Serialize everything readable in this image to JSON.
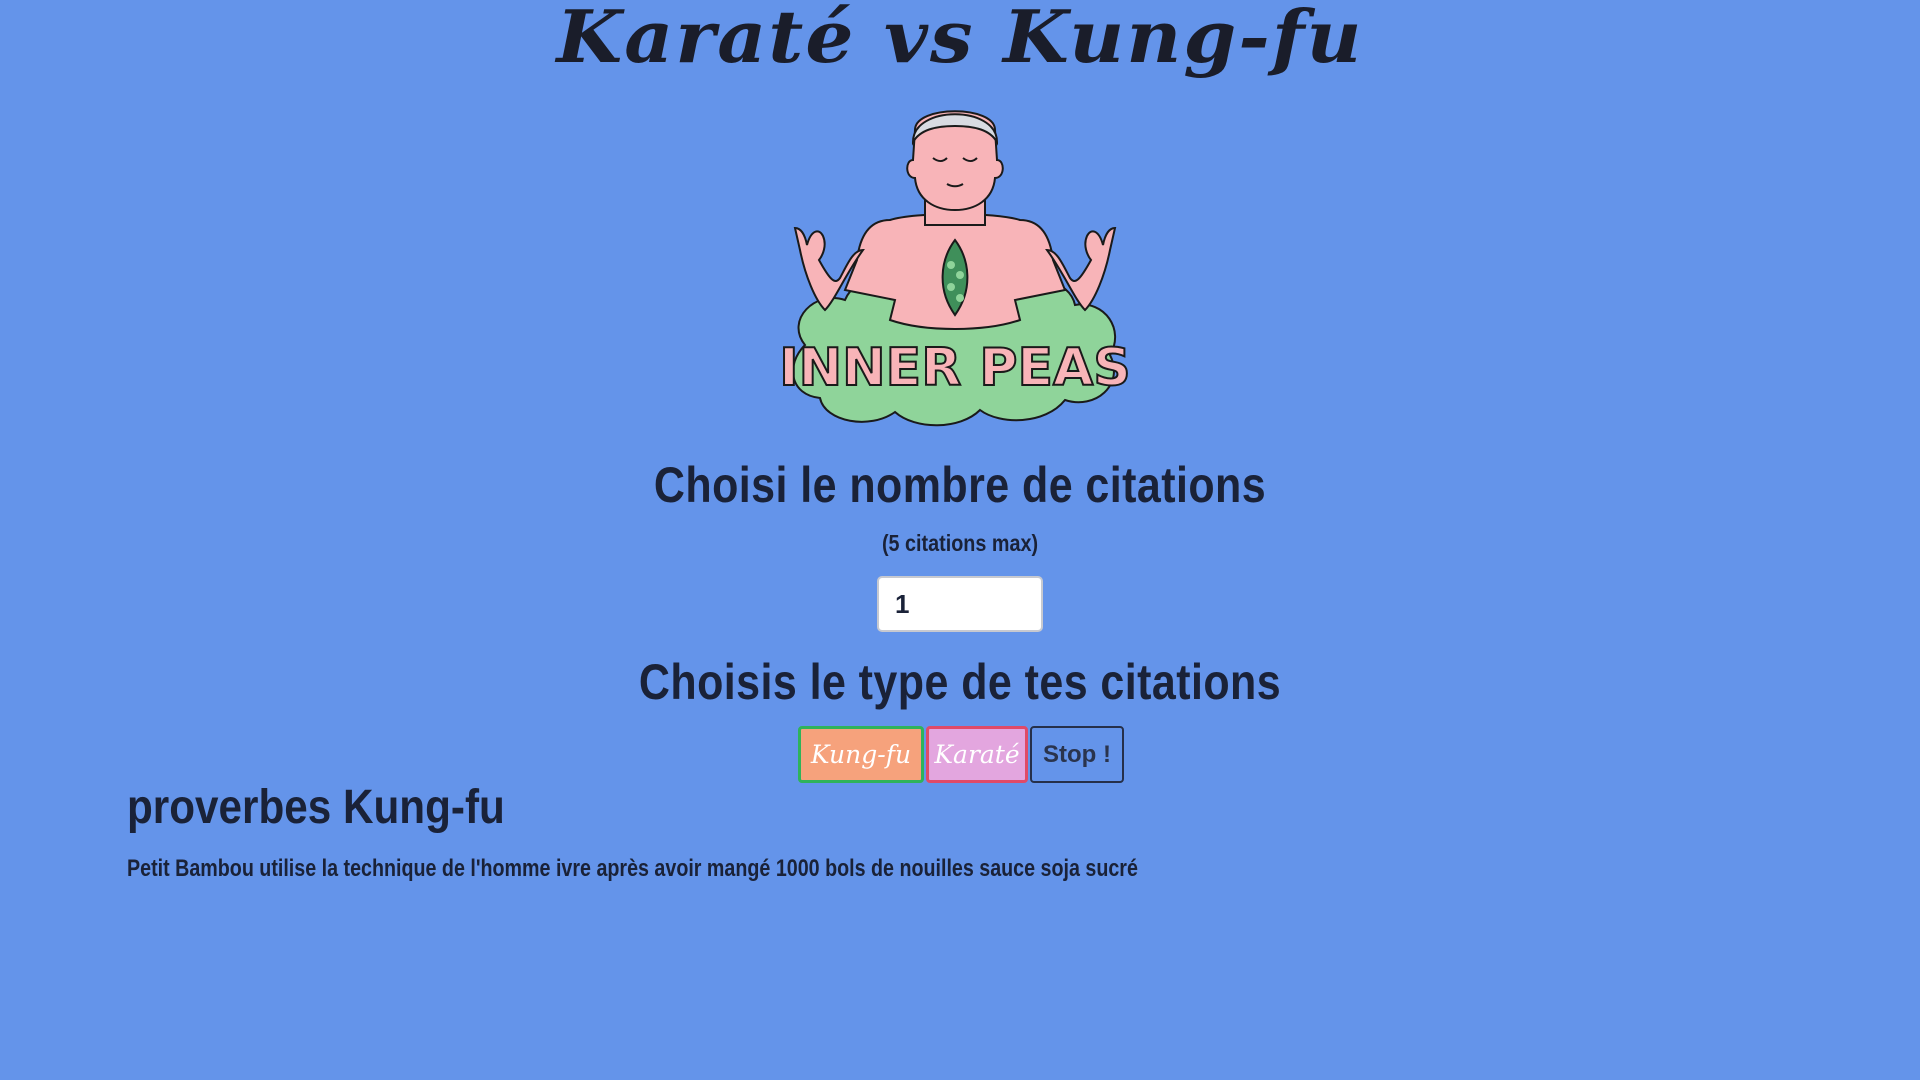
{
  "header": {
    "title": "Karaté vs Kung-fu"
  },
  "logo": {
    "text": "INNER PEAS"
  },
  "count_section": {
    "heading": "Choisi le nombre de citations",
    "hint": "(5 citations max)",
    "input_value": "1"
  },
  "type_section": {
    "heading": "Choisis le type de tes citations",
    "buttons": {
      "kungfu": "Kung-fu",
      "karate": "Karaté",
      "stop": "Stop !"
    }
  },
  "results": {
    "title": "proverbes Kung-fu",
    "quotes": [
      "Petit Bambou utilise la technique de l'homme ivre après avoir mangé 1000 bols de nouilles sauce soja sucré"
    ]
  },
  "colors": {
    "background": "#6494ea",
    "kungfu_button": "#f6a27c",
    "karate_button": "#e3a6df",
    "logo_skin": "#f8b4b8",
    "logo_cloud": "#8fd49a"
  }
}
